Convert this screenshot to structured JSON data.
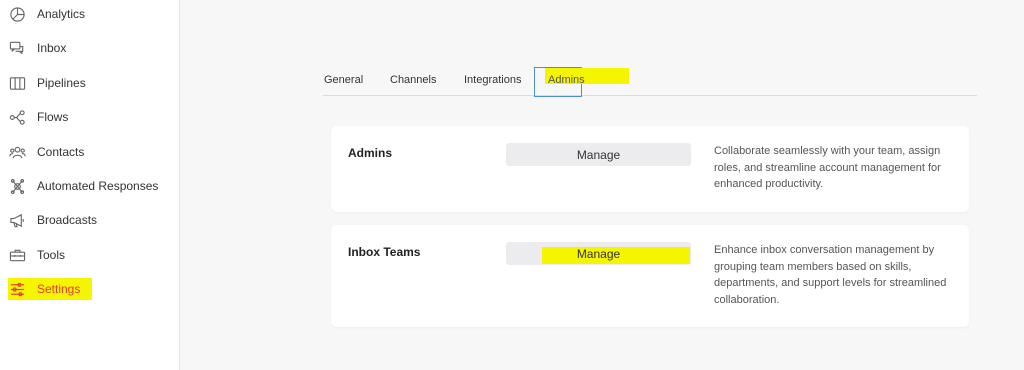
{
  "sidebar": {
    "items": [
      {
        "label": "Analytics",
        "icon": "pie-chart-icon"
      },
      {
        "label": "Inbox",
        "icon": "chat-bubbles-icon"
      },
      {
        "label": "Pipelines",
        "icon": "columns-icon"
      },
      {
        "label": "Flows",
        "icon": "flow-icon"
      },
      {
        "label": "Contacts",
        "icon": "people-icon"
      },
      {
        "label": "Automated Responses",
        "icon": "automation-icon"
      },
      {
        "label": "Broadcasts",
        "icon": "megaphone-icon"
      },
      {
        "label": "Tools",
        "icon": "toolbox-icon"
      },
      {
        "label": "Settings",
        "icon": "sliders-icon",
        "active": true
      }
    ]
  },
  "tabs": [
    {
      "label": "General"
    },
    {
      "label": "Channels"
    },
    {
      "label": "Integrations"
    },
    {
      "label": "Admins",
      "active": true
    }
  ],
  "cards": [
    {
      "title": "Admins",
      "button": "Manage",
      "description": "Collaborate seamlessly with your team, assign roles, and streamline account management for enhanced productivity."
    },
    {
      "title": "Inbox Teams",
      "button": "Manage",
      "description": "Enhance inbox conversation management by grouping team members based on skills, departments, and support levels for streamlined collaboration."
    }
  ],
  "colors": {
    "highlight": "#f5f500",
    "active_text": "#e53935",
    "focus_border": "#4a90d9"
  }
}
